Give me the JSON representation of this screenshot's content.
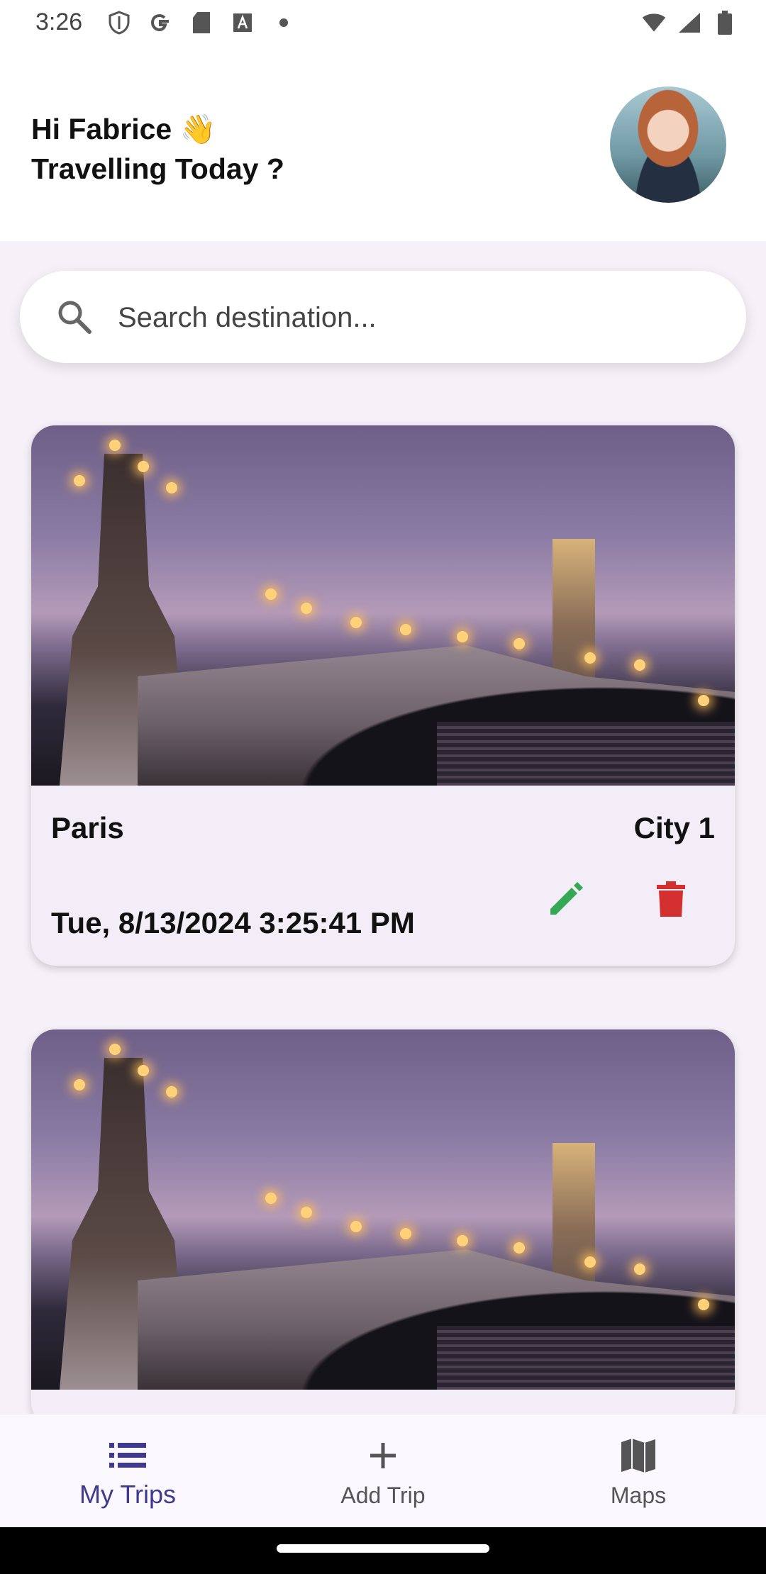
{
  "status_bar": {
    "time": "3:26",
    "left_icons": [
      "shield-icon",
      "google-icon",
      "sd-card-icon",
      "font-a-icon",
      "dot-icon"
    ],
    "right_icons": [
      "wifi-icon",
      "signal-icon",
      "battery-icon"
    ]
  },
  "header": {
    "greeting_line1": "Hi Fabrice 👋",
    "greeting_line2": "Travelling Today ?",
    "avatar_icon": "avatar"
  },
  "search": {
    "placeholder": "Search destination..."
  },
  "trips": [
    {
      "name": "Paris",
      "tag": "City 1",
      "date": "Tue, 8/13/2024 3:25:41 PM"
    },
    {
      "name": "",
      "tag": "",
      "date": ""
    }
  ],
  "colors": {
    "edit": "#34a853",
    "delete": "#d32f2f",
    "accent": "#3f3a8f"
  },
  "nav": {
    "items": [
      {
        "label": "My Trips",
        "icon": "list-icon",
        "active": true
      },
      {
        "label": "Add Trip",
        "icon": "plus-icon",
        "active": false
      },
      {
        "label": "Maps",
        "icon": "map-icon",
        "active": false
      }
    ]
  }
}
